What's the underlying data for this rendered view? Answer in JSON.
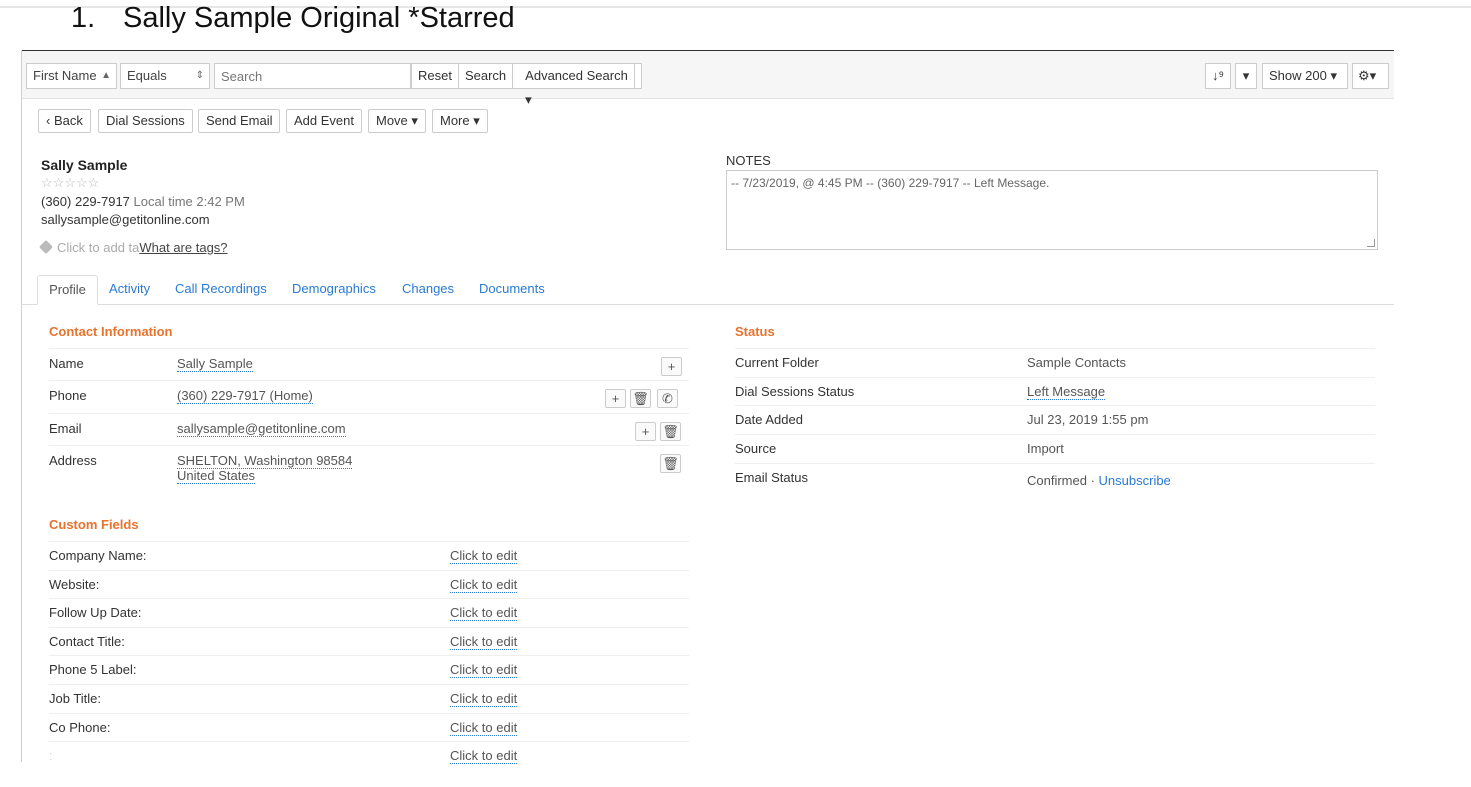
{
  "heading": {
    "number": "1.",
    "title": "Sally Sample Original *Starred"
  },
  "toolbar": {
    "field_select": "First Name",
    "operator_select": "Equals",
    "search_placeholder": "Search",
    "reset": "Reset",
    "search": "Search",
    "advanced_search": "Advanced Search",
    "sort_icon": "sort-numeric-icon",
    "show": "Show 200"
  },
  "actions": {
    "back": "Back",
    "dial_sessions": "Dial Sessions",
    "send_email": "Send Email",
    "add_event": "Add Event",
    "move": "Move",
    "more": "More"
  },
  "contact": {
    "name": "Sally Sample",
    "stars": "☆☆☆☆☆",
    "phone": "(360) 229-7917",
    "local_time": "Local time 2:42 PM",
    "email": "sallysample@getitonline.com",
    "tag_placeholder": "Click to add ta",
    "tag_help": "What are tags?"
  },
  "notes": {
    "label": "NOTES",
    "text": "-- 7/23/2019, @ 4:45 PM -- (360) 229-7917 -- Left Message."
  },
  "tabs": [
    "Profile",
    "Activity",
    "Call Recordings",
    "Demographics",
    "Changes",
    "Documents"
  ],
  "contact_info": {
    "title": "Contact Information",
    "rows": [
      {
        "label": "Name",
        "value": "Sally Sample"
      },
      {
        "label": "Phone",
        "value": "(360) 229-7917 (Home)"
      },
      {
        "label": "Email",
        "value": "sallysample@getitonline.com"
      },
      {
        "label": "Address",
        "value": "SHELTON, Washington 98584",
        "value2": "United States"
      }
    ]
  },
  "custom_fields": {
    "title": "Custom Fields",
    "edit_text": "Click to edit",
    "rows": [
      "Company Name:",
      "Website:",
      "Follow Up Date:",
      "Contact Title:",
      "Phone 5 Label:",
      "Job Title:",
      "Co Phone:",
      ":"
    ]
  },
  "status": {
    "title": "Status",
    "rows": [
      {
        "label": "Current Folder",
        "value": "Sample Contacts"
      },
      {
        "label": "Dial Sessions Status",
        "value": "Left Message"
      },
      {
        "label": "Date Added",
        "value": "Jul 23, 2019 1:55 pm"
      },
      {
        "label": "Source",
        "value": "Import"
      },
      {
        "label": "Email Status",
        "value": "Confirmed",
        "sep": " · ",
        "link": "Unsubscribe"
      }
    ]
  },
  "colors": {
    "accent": "#f07a2b",
    "link": "#2a7ad0",
    "section_title": "#e8732e"
  }
}
